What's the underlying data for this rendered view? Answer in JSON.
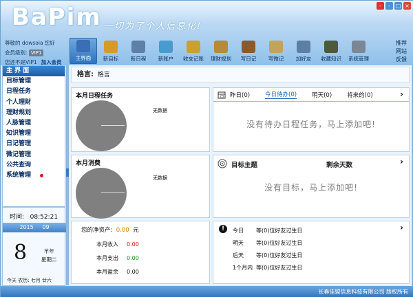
{
  "app": {
    "logo": "BaPim",
    "slogan": "一切为了个人信息化!"
  },
  "window_controls": [
    "-",
    "-",
    "□",
    "×"
  ],
  "user": {
    "greeting": "尊敬的 dowsoia 您好",
    "level_label": "会员级别:",
    "level_value": "VIP1",
    "vip_note": "您还不是VIP1",
    "join_label": "加入会员"
  },
  "toolbar": [
    {
      "label": "主界面",
      "icon": "monitor-icon",
      "color": "#3a6fb5",
      "active": true
    },
    {
      "label": "新目标",
      "icon": "medal-icon",
      "color": "#d49a2a",
      "active": false
    },
    {
      "label": "新日程",
      "icon": "calendar-icon",
      "color": "#5e7fa8",
      "active": false
    },
    {
      "label": "新账户",
      "icon": "card-icon",
      "color": "#4a9ad0",
      "active": false
    },
    {
      "label": "收支记账",
      "icon": "coins-icon",
      "color": "#c9a12c",
      "active": false
    },
    {
      "label": "理财规划",
      "icon": "clipboard-icon",
      "color": "#b58a3a",
      "active": false
    },
    {
      "label": "写日记",
      "icon": "diary-icon",
      "color": "#8b5a2b",
      "active": false
    },
    {
      "label": "写微记",
      "icon": "note-icon",
      "color": "#c1a35b",
      "active": false
    },
    {
      "label": "加好友",
      "icon": "contacts-icon",
      "color": "#5d7fa3",
      "active": false
    },
    {
      "label": "收藏知识",
      "icon": "book-icon",
      "color": "#4b5a3a",
      "active": false
    },
    {
      "label": "系统管理",
      "icon": "gear-icon",
      "color": "#7b8794",
      "active": false
    }
  ],
  "right_links": [
    "推荐",
    "网站",
    "反馈"
  ],
  "sidebar": [
    {
      "label": "主 界 面"
    },
    {
      "label": "目标管理"
    },
    {
      "label": "日程任务"
    },
    {
      "label": "个人理财"
    },
    {
      "label": "理财规划"
    },
    {
      "label": "人脉管理"
    },
    {
      "label": "知识管理"
    },
    {
      "label": "日记管理"
    },
    {
      "label": "微记管理"
    },
    {
      "label": "公共查询"
    },
    {
      "label": "系统管理"
    }
  ],
  "clock": {
    "time_label": "时间:",
    "time": "08:52:21",
    "year": "2015",
    "month": "09",
    "day": "8",
    "lunar_year": "羊年",
    "weekday": "星期二",
    "lunar_line": "今天   农历: 七月 廿六"
  },
  "motto": {
    "label": "格言:",
    "value": "格言"
  },
  "month_tasks": {
    "title": "本月日程任务",
    "nodata": "无数据"
  },
  "month_spend": {
    "title": "本月消费",
    "nodata": "无数据"
  },
  "schedule": {
    "tabs": [
      {
        "label": "昨日(0)",
        "active": false
      },
      {
        "label": "今日待办(0)",
        "active": true
      },
      {
        "label": "明天(0)",
        "active": false
      },
      {
        "label": "将来的(0)",
        "active": false
      }
    ],
    "empty": "没有待办日程任务，马上添加吧!"
  },
  "goals": {
    "title": "目标主题",
    "days_col": "剩余天数",
    "empty": "没有目标，马上添加吧!"
  },
  "assets": {
    "label": "您的净资产:",
    "value": "0.00",
    "unit": "元",
    "rows": [
      {
        "label": "本月收入",
        "value": "0.00",
        "color": "#d01010"
      },
      {
        "label": "本月支出",
        "value": "0.00",
        "color": "#1a8a1a"
      },
      {
        "label": "本月盈余",
        "value": "0.00",
        "color": "#111111"
      }
    ]
  },
  "birthdays": {
    "rows": [
      {
        "when": "今日",
        "text": "等(0)位好友过生日"
      },
      {
        "when": "明天",
        "text": "等(0)位好友过生日"
      },
      {
        "when": "后天",
        "text": "等(0)位好友过生日"
      },
      {
        "when": "1个月内",
        "text": "等(0)位好友过生日"
      }
    ]
  },
  "status": {
    "text": "长春佳盟信息科技有限公司   版权所有"
  }
}
